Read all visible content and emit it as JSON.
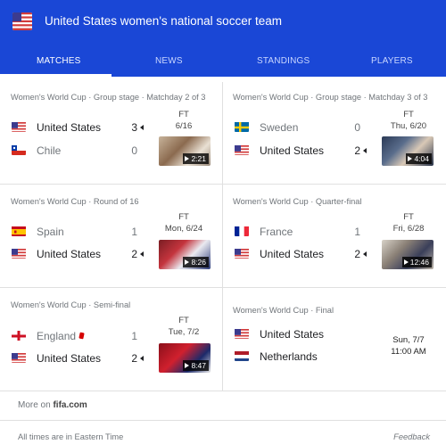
{
  "header": {
    "title": "United States women's national soccer team",
    "flag_icon": "us-flag-icon",
    "background": "#1a47d6"
  },
  "tabs": [
    {
      "label": "MATCHES",
      "active": true
    },
    {
      "label": "NEWS",
      "active": false
    },
    {
      "label": "STANDINGS",
      "active": false
    },
    {
      "label": "PLAYERS",
      "active": false
    }
  ],
  "matches": [
    {
      "stage": "Women's World Cup · Group stage · Matchday 2 of 3",
      "team1": {
        "name": "United States",
        "flag": "us",
        "score": "3",
        "winner": true
      },
      "team2": {
        "name": "Chile",
        "flag": "cl",
        "score": "0",
        "winner": false
      },
      "status": "FT",
      "date": "6/16",
      "video_duration": "2:21"
    },
    {
      "stage": "Women's World Cup · Group stage · Matchday 3 of 3",
      "team1": {
        "name": "Sweden",
        "flag": "se",
        "score": "0",
        "winner": false
      },
      "team2": {
        "name": "United States",
        "flag": "us",
        "score": "2",
        "winner": true
      },
      "status": "FT",
      "date": "Thu, 6/20",
      "video_duration": "4:04"
    },
    {
      "stage": "Women's World Cup · Round of 16",
      "team1": {
        "name": "Spain",
        "flag": "es",
        "score": "1",
        "winner": false
      },
      "team2": {
        "name": "United States",
        "flag": "us",
        "score": "2",
        "winner": true
      },
      "status": "FT",
      "date": "Mon, 6/24",
      "video_duration": "8:26"
    },
    {
      "stage": "Women's World Cup · Quarter-final",
      "team1": {
        "name": "France",
        "flag": "fr",
        "score": "1",
        "winner": false
      },
      "team2": {
        "name": "United States",
        "flag": "us",
        "score": "2",
        "winner": true
      },
      "status": "FT",
      "date": "Fri, 6/28",
      "video_duration": "12:46"
    },
    {
      "stage": "Women's World Cup · Semi-final",
      "team1": {
        "name": "England",
        "flag": "en",
        "score": "1",
        "winner": false,
        "red_card": true
      },
      "team2": {
        "name": "United States",
        "flag": "us",
        "score": "2",
        "winner": true
      },
      "status": "FT",
      "date": "Tue, 7/2",
      "video_duration": "8:47"
    },
    {
      "stage": "Women's World Cup · Final",
      "team1": {
        "name": "United States",
        "flag": "us"
      },
      "team2": {
        "name": "Netherlands",
        "flag": "nl"
      },
      "date": "Sun, 7/7",
      "time": "11:00 AM"
    }
  ],
  "more": {
    "prefix": "More on ",
    "site": "fifa.com"
  },
  "footer": {
    "timezone_note": "All times are in Eastern Time",
    "feedback": "Feedback"
  }
}
